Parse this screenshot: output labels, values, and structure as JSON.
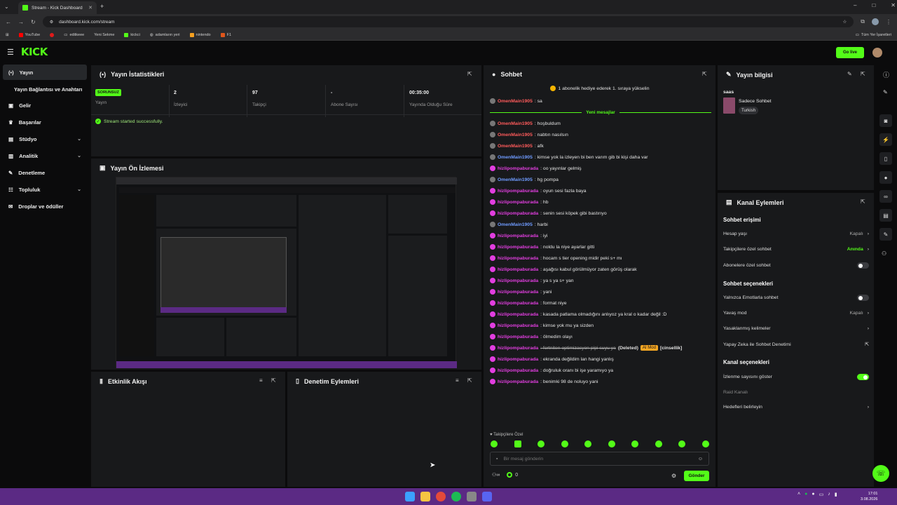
{
  "browser": {
    "tab_title": "Stream - Kick Dashboard",
    "url": "dashboard.kick.com/stream",
    "bookmarks": [
      "YouTube",
      "editkeee",
      "Yeni Sekme",
      "kickci",
      "adamların yeri",
      "nintendo",
      "F1"
    ],
    "all_bookmarks": "Tüm Yer İşaretleri"
  },
  "header": {
    "logo": "KICK",
    "go_live": "Go live"
  },
  "sidebar": {
    "items": [
      {
        "label": "Yayın"
      },
      {
        "label": "Yayın Bağlantısı ve Anahtarı"
      },
      {
        "label": "Gelir"
      },
      {
        "label": "Başarılar"
      },
      {
        "label": "Stüdyo"
      },
      {
        "label": "Analitik"
      },
      {
        "label": "Denetleme"
      },
      {
        "label": "Topluluk"
      },
      {
        "label": "Droplar ve ödüller"
      }
    ]
  },
  "stats": {
    "title": "Yayın İstatistikleri",
    "badge": "SORUNSUZ",
    "stream_label": "Yayın",
    "viewers_value": "2",
    "viewers_label": "İzleyici",
    "followers_value": "97",
    "followers_label": "Takipçi",
    "subs_value": "-",
    "subs_label": "Abone Sayısı",
    "time_value": "00:35:00",
    "time_label": "Yayında Olduğu Süre",
    "success": "Stream started successfully."
  },
  "preview": {
    "title": "Yayın Ön İzlemesi"
  },
  "activity": {
    "title": "Etkinlik Akışı"
  },
  "moderation": {
    "title": "Denetim Eylemleri"
  },
  "chat": {
    "title": "Sohbet",
    "pinned": "1 abonelik hediye ederek 1. sıraya yükselin",
    "new_messages": "Yeni mesajlar",
    "messages": [
      {
        "user": "OmenMain1905",
        "text": ": sa",
        "color": "#ff5b5b"
      },
      {
        "user": "OmenMain1905",
        "text": ": hoşbuldum",
        "color": "#ff5b5b"
      },
      {
        "user": "OmenMain1905",
        "text": ": nabtın nasılsın",
        "color": "#ff5b5b"
      },
      {
        "user": "OmenMain1905",
        "text": ": afk",
        "color": "#ff5b5b"
      },
      {
        "user": "OmenMain1905",
        "text": ": kimse yok la izleyen bi ben varım gib bi kişi daha var",
        "color": "#6f9bff"
      },
      {
        "user": "hizlipompaburada",
        "text": ": oo yayınlar gelmiş",
        "color": "#e23ee0"
      },
      {
        "user": "OmenMain1905",
        "text": ": hg pompa",
        "color": "#6f9bff"
      },
      {
        "user": "hizlipompaburada",
        "text": ": oyun sesi fazla baya",
        "color": "#e23ee0"
      },
      {
        "user": "hizlipompaburada",
        "text": ": hb",
        "color": "#e23ee0"
      },
      {
        "user": "hizlipompaburada",
        "text": ": senin sesi köpek gibi bastırıyo",
        "color": "#e23ee0"
      },
      {
        "user": "OmenMain1905",
        "text": ": harbi",
        "color": "#6f9bff"
      },
      {
        "user": "hizlipompaburada",
        "text": ": iyi",
        "color": "#e23ee0"
      },
      {
        "user": "hizlipompaburada",
        "text": ": noldu la niye ayarlar gitti",
        "color": "#e23ee0"
      },
      {
        "user": "hizlipompaburada",
        "text": ": hocam s tier opening midir peki s+ mı",
        "color": "#e23ee0"
      },
      {
        "user": "hizlipompaburada",
        "text": ": aşağısı kabul görülmüyor zaten görüş olarak",
        "color": "#e23ee0"
      },
      {
        "user": "hizlipompaburada",
        "text": ": ya s ya s+ yan",
        "color": "#e23ee0"
      },
      {
        "user": "hizlipompaburada",
        "text": ": yani",
        "color": "#e23ee0"
      },
      {
        "user": "hizlipompaburada",
        "text": ": format niye",
        "color": "#e23ee0"
      },
      {
        "user": "hizlipompaburada",
        "text": ": kasada patlama olmadığını anlıyoz ya kral o kadar değil :D",
        "color": "#e23ee0"
      },
      {
        "user": "hizlipompaburada",
        "text": ": kimse yok mu ya sizden",
        "color": "#e23ee0"
      },
      {
        "user": "hizlipompaburada",
        "text": ": ölmedim olayı",
        "color": "#e23ee0"
      },
      {
        "user": "hizlipompaburada",
        "text": ": fortniten optimizasyon pipi suyu ya",
        "color": "#e23ee0",
        "deleted": "(Deleted)",
        "ai": "AI Mod",
        "tag": "[cinsellik]"
      },
      {
        "user": "hizlipompaburada",
        "text": ": ekranda değildim lan hangi yanlış",
        "color": "#e23ee0"
      },
      {
        "user": "hizlipompaburada",
        "text": ": doğruluk oranı bi işe yaramıyo ya",
        "color": "#e23ee0"
      },
      {
        "user": "hizlipompaburada",
        "text": ": benimki 98 de noluyo yani",
        "color": "#e23ee0"
      }
    ],
    "followers_only": "Takipçilere Özel",
    "placeholder": "Bir mesaj gönderin",
    "points": "0",
    "send": "Gönder"
  },
  "info": {
    "title": "Yayın bilgisi",
    "stream_title": "saas",
    "category": "Sadece Sohbet",
    "language": "Turkish"
  },
  "actions": {
    "title": "Kanal Eylemleri",
    "chat_access": "Sohbet erişimi",
    "account_age": "Hesap yaşı",
    "account_age_value": "Kapalı",
    "followers_chat": "Takipçilere özel sohbet",
    "followers_chat_value": "Anında",
    "subs_chat": "Abonelere özel sohbet",
    "chat_options": "Sohbet seçenekleri",
    "emotes_only": "Yalnızca Emotlarla sohbet",
    "slow_mode": "Yavaş mod",
    "slow_mode_value": "Kapalı",
    "banned_words": "Yasaklanmış kelimeler",
    "ai_moderation": "Yapay Zeka ile Sohbet Denetimi",
    "channel_options": "Kanal seçenekleri",
    "show_viewers": "İzlenme sayısını göster",
    "raid_channel": "Raid Kanalı",
    "set_targets": "Hedefleri belirleyin"
  },
  "taskbar": {
    "time": "17:01",
    "date": "3.08.2026"
  },
  "colors": {
    "accent": "#53fc18",
    "panel": "#18191b",
    "bg": "#0b0b0c"
  }
}
